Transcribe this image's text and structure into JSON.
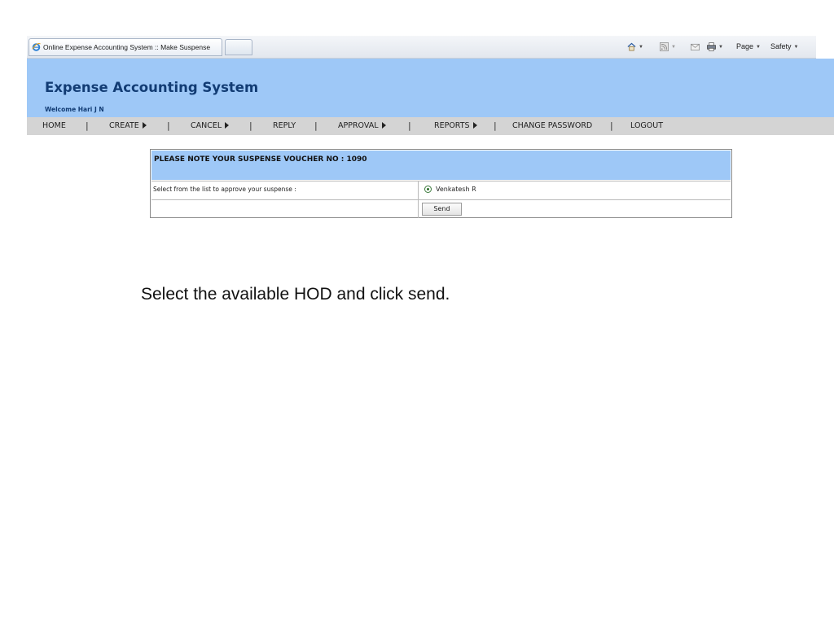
{
  "browser": {
    "tab_title": "Online Expense Accounting System :: Make Suspense",
    "commands": {
      "page_label": "Page",
      "safety_label": "Safety"
    }
  },
  "app": {
    "title": "Expense Accounting System",
    "welcome": "Welcome Hari J N"
  },
  "nav": {
    "items": [
      {
        "label": "HOME"
      },
      {
        "label": "CREATE"
      },
      {
        "label": "CANCEL"
      },
      {
        "label": "REPLY"
      },
      {
        "label": "APPROVAL"
      },
      {
        "label": "REPORTS"
      },
      {
        "label": "CHANGE PASSWORD"
      },
      {
        "label": "LOGOUT"
      }
    ],
    "separator": "|"
  },
  "voucher": {
    "header": "PLEASE NOTE YOUR SUSPENSE VOUCHER NO : 1090",
    "select_label": "Select from the list to approve your suspense :",
    "approver_option": "Venkatesh R",
    "send_label": "Send"
  },
  "instruction": "Select the available HOD and click send.",
  "colors": {
    "header_bg": "#9ec8f7",
    "title_color": "#123c74",
    "nav_bg": "#d4d4d4"
  }
}
